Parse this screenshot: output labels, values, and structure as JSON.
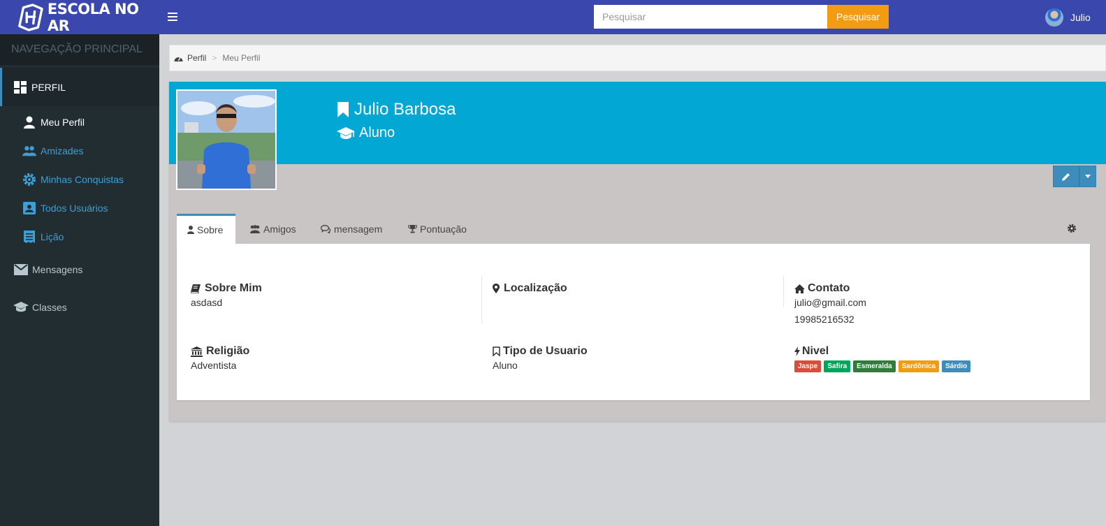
{
  "brand": {
    "name": "ESCOLA NO AR"
  },
  "header": {
    "search_placeholder": "Pesquisar",
    "search_button": "Pesquisar",
    "user_name": "Julio"
  },
  "sidebar": {
    "header": "NAVEGAÇÃO PRINCIPAL",
    "perfil": "PERFIL",
    "sub_items": [
      {
        "label": "Meu Perfil",
        "icon": "person-icon",
        "active": true
      },
      {
        "label": "Amizades",
        "icon": "people-icon"
      },
      {
        "label": "Minhas Conquistas",
        "icon": "badge-gear-icon"
      },
      {
        "label": "Todos Usuários",
        "icon": "contact-card-icon"
      },
      {
        "label": "Lição",
        "icon": "receipt-icon"
      }
    ],
    "items": [
      {
        "label": "Mensagens",
        "icon": "envelope-icon"
      },
      {
        "label": "Classes",
        "icon": "graduation-cap-icon"
      }
    ]
  },
  "breadcrumb": {
    "home": "Perfil",
    "separator": ">",
    "current": "Meu Perfil"
  },
  "profile": {
    "name": "Julio Barbosa",
    "role": "Aluno"
  },
  "tabs": [
    {
      "label": "Sobre",
      "icon": "user-icon"
    },
    {
      "label": "Amigos",
      "icon": "users-icon"
    },
    {
      "label": "mensagem",
      "icon": "comments-icon"
    },
    {
      "label": "Pontuação",
      "icon": "trophy-icon"
    }
  ],
  "about": {
    "sobre_title": "Sobre Mim",
    "sobre_value": "asdasd",
    "local_title": "Localização",
    "contato_title": "Contato",
    "email": "julio@gmail.com",
    "phone": "19985216532",
    "religiao_title": "Religião",
    "religiao_value": "Adventista",
    "tipo_title": "Tipo de Usuario",
    "tipo_value": "Aluno",
    "nivel_title": "Nivel",
    "levels": [
      {
        "label": "Jaspe",
        "color": "#dd4b39"
      },
      {
        "label": "Safira",
        "color": "#00a65a"
      },
      {
        "label": "Esmeralda",
        "color": "#2e7d3a"
      },
      {
        "label": "Sardônica",
        "color": "#f39c12"
      },
      {
        "label": "Sárdio",
        "color": "#3c8dbc"
      }
    ]
  },
  "colors": {
    "topbar": "#3a47ad",
    "sidebar": "#222d32",
    "cover": "#02a7d4",
    "accent": "#3c8dbc",
    "search_button": "#f39c12"
  }
}
